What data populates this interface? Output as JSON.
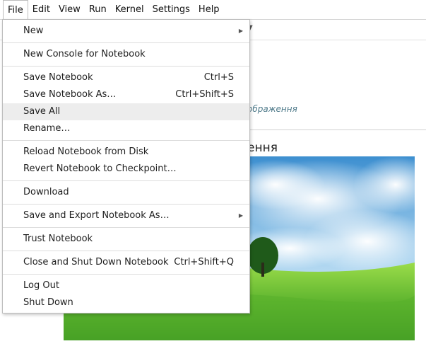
{
  "menubar": {
    "items": [
      "File",
      "Edit",
      "View",
      "Run",
      "Kernel",
      "Settings",
      "Help"
    ]
  },
  "notebook": {
    "link_text": "ображення",
    "heading": "ення"
  },
  "file_menu": {
    "new": {
      "label": "New"
    },
    "new_console": {
      "label": "New Console for Notebook"
    },
    "save_notebook": {
      "label": "Save Notebook",
      "shortcut": "Ctrl+S"
    },
    "save_notebook_as": {
      "label": "Save Notebook As…",
      "shortcut": "Ctrl+Shift+S"
    },
    "save_all": {
      "label": "Save All"
    },
    "rename": {
      "label": "Rename…"
    },
    "reload": {
      "label": "Reload Notebook from Disk"
    },
    "revert": {
      "label": "Revert Notebook to Checkpoint…"
    },
    "download": {
      "label": "Download"
    },
    "save_export": {
      "label": "Save and Export Notebook As…"
    },
    "trust": {
      "label": "Trust Notebook"
    },
    "close_shutdown": {
      "label": "Close and Shut Down Notebook",
      "shortcut": "Ctrl+Shift+Q"
    },
    "log_out": {
      "label": "Log Out"
    },
    "shut_down": {
      "label": "Shut Down"
    }
  },
  "icons": {
    "submenu": "chevron-right-icon",
    "toolbar_caret": "chevron-down-icon"
  },
  "colors": {
    "hover_bg": "#ededed",
    "link": "#4f7a8a",
    "sky": "#4f9fd8",
    "grass": "#6cc23a"
  }
}
